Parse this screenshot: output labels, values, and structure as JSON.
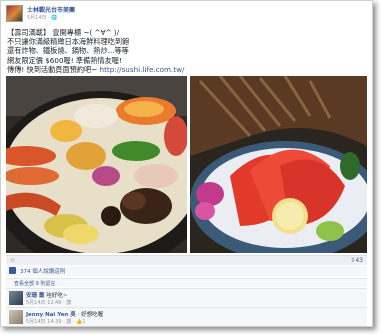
{
  "header": {
    "page_name": "士林觀光台市美團",
    "meta": "5月14日 · 🌐"
  },
  "post": {
    "lines": [
      "【壽司滿載】 壹開專櫃 ~( ^∀^ )/",
      "不只讓你滿級精緻日本海鮮料理吃到飽",
      "還有炸物、鐵板燒、鍋物、熱炒...等等",
      "網友限定價 $600喔! 準備熱情友喔!",
      "傳傳! 快到活動頁面預約吧~ "
    ],
    "link": "http://sushi.life.com.tw/"
  },
  "actions": {
    "left_icon": "☆",
    "right_icon": "⇧43"
  },
  "likes": {
    "text": "374 個人說讚這則"
  },
  "view_all": {
    "text": "查看全部 9 則留言"
  },
  "comments": [
    {
      "name": "安珊 蕭",
      "text": "哇好吃~",
      "meta": "5月14日 12:46 · 讚"
    },
    {
      "name": "Jenny Nai Yen 吳",
      "text": "· 好想吃喔",
      "meta": "5月14日 14:39 · 讚 · 👍1"
    }
  ]
}
